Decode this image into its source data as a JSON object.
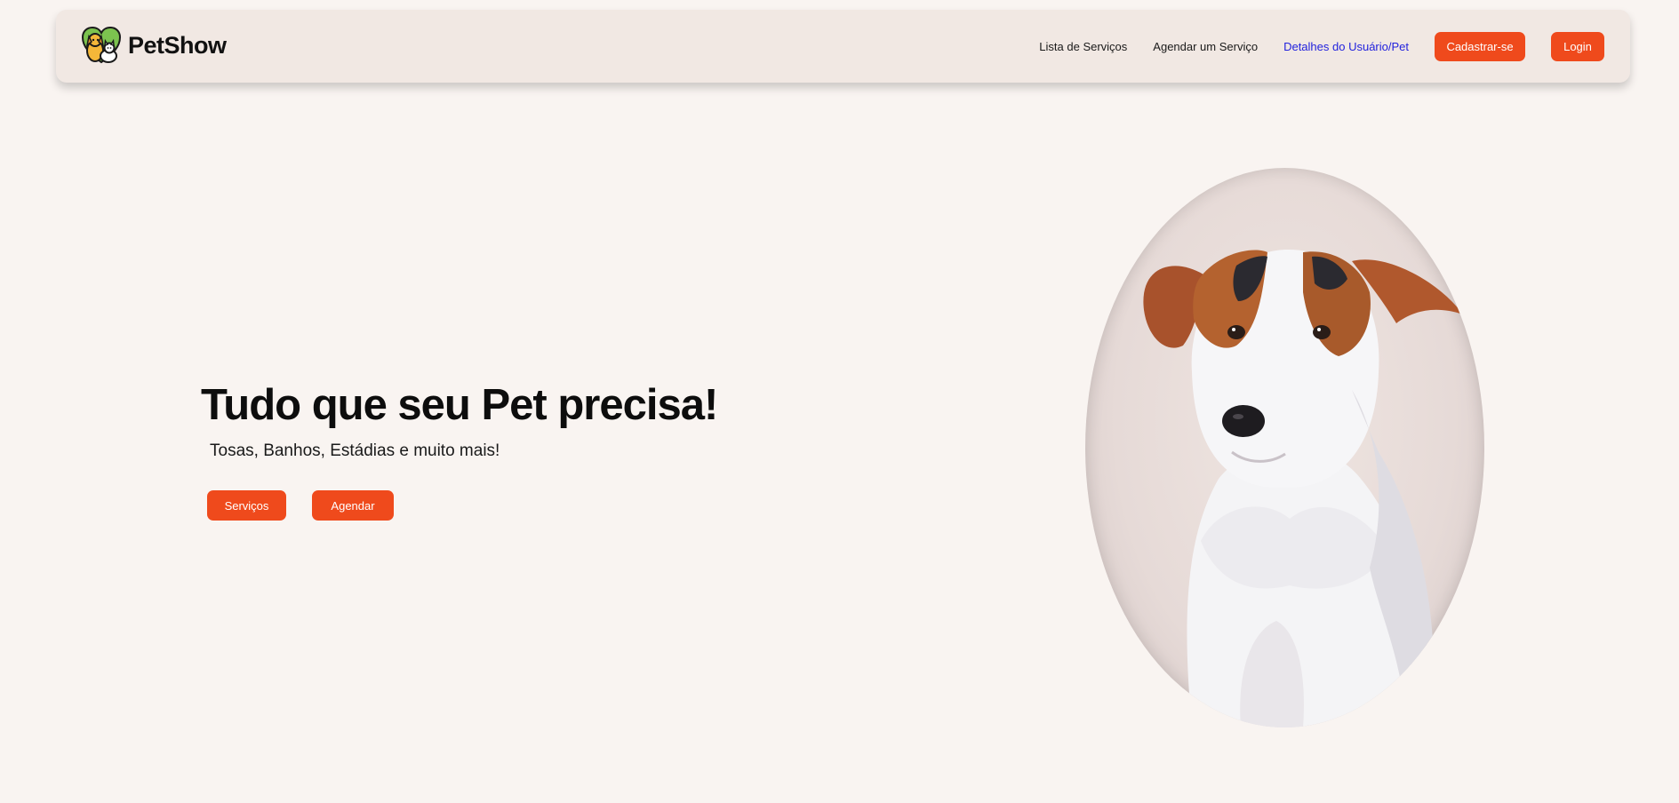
{
  "brand": {
    "name": "PetShow",
    "logo_icon": "dog-cat-heart-logo"
  },
  "nav": {
    "links": [
      {
        "label": "Lista de Serviços"
      },
      {
        "label": "Agendar um Serviço"
      },
      {
        "label": "Detalhes do Usuário/Pet"
      }
    ],
    "signup_label": "Cadastrar-se",
    "login_label": "Login"
  },
  "hero": {
    "title": "Tudo que seu Pet precisa!",
    "subtitle": "Tosas, Banhos, Estádias e muito mais!",
    "services_button": "Serviços",
    "schedule_button": "Agendar",
    "image_icon": "jack-russell-dog-photo"
  },
  "colors": {
    "accent": "#ef4a1c",
    "background": "#f9f4f1",
    "navbar": "#f1e8e3",
    "active_link": "#2222dd"
  }
}
